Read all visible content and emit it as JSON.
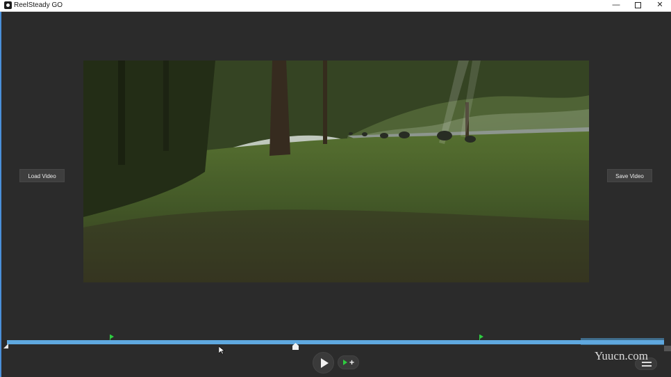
{
  "window": {
    "title": "ReelSteady GO",
    "minimize_glyph": "—",
    "close_glyph": "✕"
  },
  "actions": {
    "load_label": "Load Video",
    "save_label": "Save Video"
  },
  "timeline": {
    "marker_glyph": "flag-icon",
    "add_marker_glyph": "+"
  },
  "watermark": {
    "text": "Yuucn.com"
  },
  "colors": {
    "accent": "#5fa8df",
    "marker": "#2ecc40",
    "background": "#2b2b2b"
  }
}
